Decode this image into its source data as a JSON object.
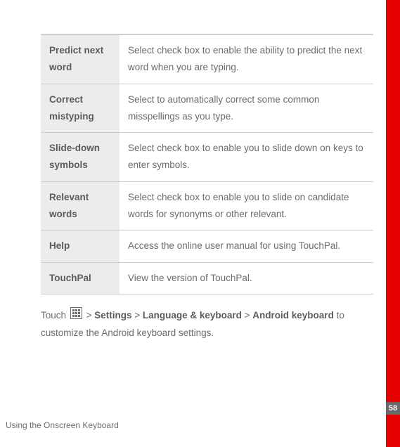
{
  "settings_table": {
    "rows": [
      {
        "label": "Predict next word",
        "desc": "Select check box to enable the ability to predict the next word when you are typing."
      },
      {
        "label": "Correct mistyping",
        "desc": "Select to automatically correct some common misspellings as you type."
      },
      {
        "label": "Slide-down symbols",
        "desc": "Select check box to enable you to slide down on keys to enter symbols."
      },
      {
        "label": "Relevant words",
        "desc": "Select check box to enable you to slide on candidate words for synonyms or other relevant."
      },
      {
        "label": "Help",
        "desc": "Access the online user manual for using TouchPal."
      },
      {
        "label": "TouchPal",
        "desc": "View the version of TouchPal."
      }
    ]
  },
  "instruction": {
    "pre": "Touch",
    "sep": " > ",
    "path1": "Settings",
    "path2": "Language & keyboard",
    "path3": "Android keyboard",
    "post": " to customize the Android keyboard settings."
  },
  "footer": {
    "section": "Using the Onscreen Keyboard"
  },
  "page": {
    "number": "58"
  }
}
